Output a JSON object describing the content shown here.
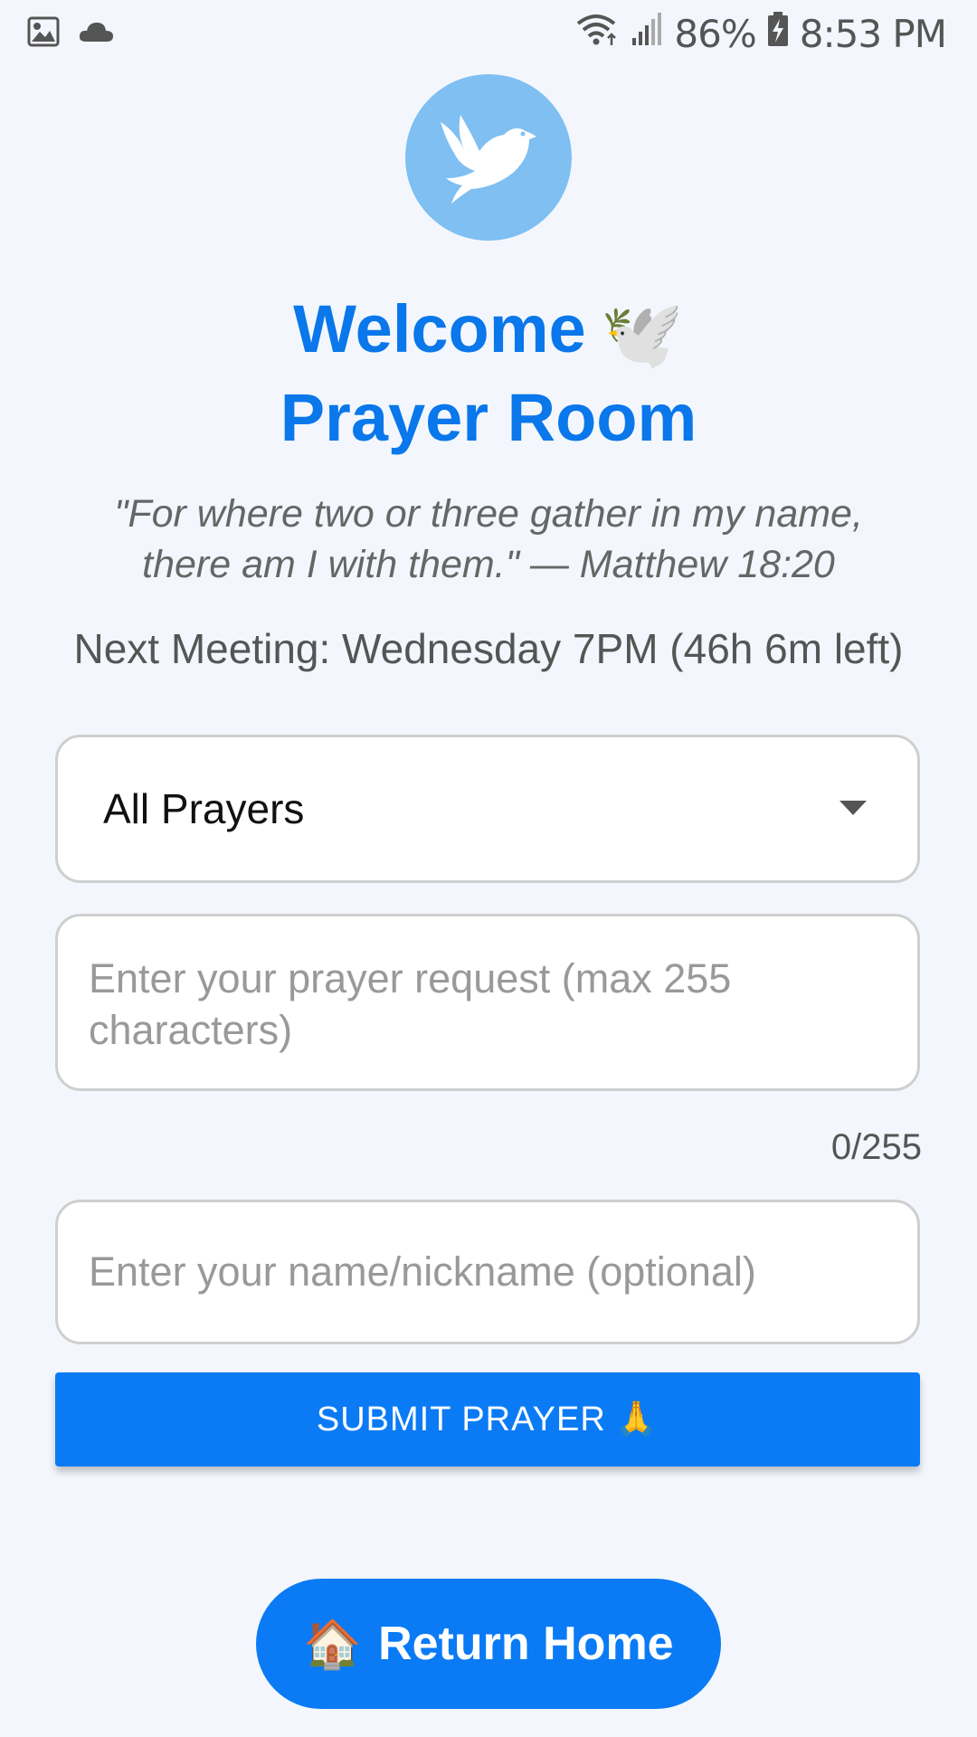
{
  "status_bar": {
    "left_icons": [
      "image-icon",
      "cloud-icon"
    ],
    "right_icons": [
      "wifi-icon",
      "signal-icon",
      "battery-icon"
    ],
    "battery": "86%",
    "time": "8:53 PM"
  },
  "header": {
    "logo_icon": "dove-icon",
    "title_line1": "Welcome",
    "title_emoji": "🕊️",
    "title_line2": "Prayer Room",
    "verse_line1": "\"For where two or three gather in my name,",
    "verse_line2": "there am I with them.\" — Matthew 18:20",
    "next_meeting": "Next Meeting: Wednesday 7PM (46h 6m left)"
  },
  "form": {
    "filter_value": "All Prayers",
    "request_placeholder": "Enter your prayer request (max 255 characters)",
    "request_value": "",
    "counter": "0/255",
    "name_placeholder": "Enter your name/nickname (optional)",
    "name_value": "",
    "submit_label": "SUBMIT PRAYER",
    "submit_emoji": "🙏"
  },
  "footer": {
    "home_emoji": "🏠",
    "home_label": "Return Home"
  },
  "colors": {
    "background": "#f3f7fd",
    "primary": "#0a7bf5",
    "title": "#0a77ea",
    "logo_bg": "#7fbff2"
  }
}
